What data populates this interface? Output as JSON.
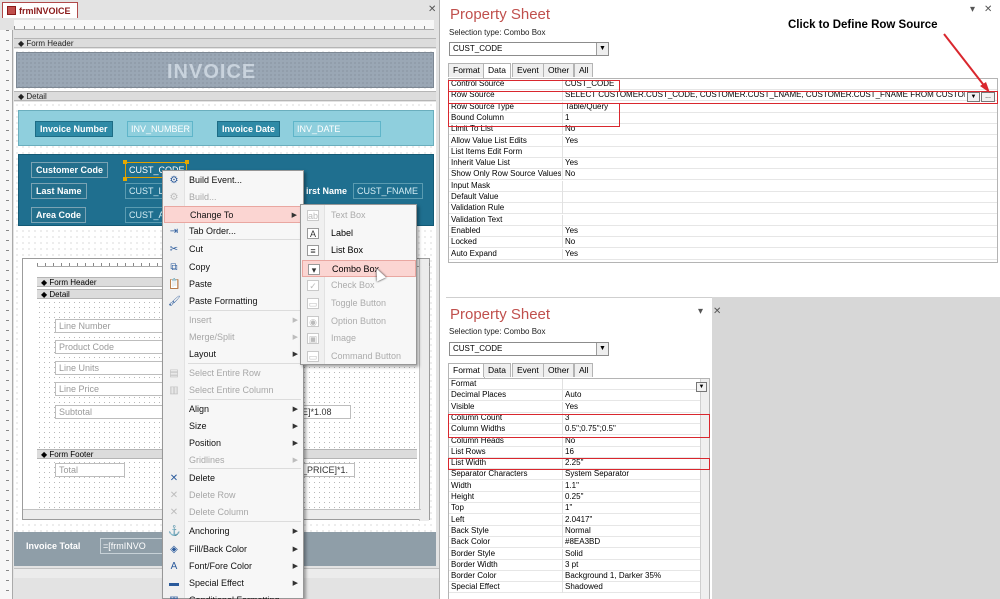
{
  "designer": {
    "tab_label": "frmINVOICE",
    "form_header_section": "Form Header",
    "detail_section": "Detail",
    "invoice_title": "INVOICE",
    "fields": {
      "invoice_number_label": "Invoice Number",
      "invoice_number_value": "INV_NUMBER",
      "invoice_date_label": "Invoice Date",
      "invoice_date_value": "INV_DATE",
      "customer_code_label": "Customer Code",
      "customer_code_value": "CUST_CODE",
      "last_name_label": "Last Name",
      "last_name_value": "CUST_L",
      "first_name_label": "irst Name",
      "first_name_value": "CUST_FNAME",
      "area_code_label": "Area Code",
      "area_code_value": "CUST_A"
    },
    "subform": {
      "form_header_section": "Form Header",
      "detail_section": "Detail",
      "form_footer_section": "Form Footer",
      "detail_fields": [
        "Line Number",
        "Product Code",
        "Line Units",
        "Line Price",
        "Subtotal"
      ],
      "subtotal_expr": "E]*1.08",
      "total_label": "Total",
      "total_expr": "_PRICE]*1."
    },
    "footer": {
      "invoice_total_label": "Invoice Total",
      "invoice_total_expr": "=[frmINVO"
    }
  },
  "context_menu": {
    "items": [
      {
        "label": "Build Event...",
        "icon": "build-event-icon",
        "disabled": false,
        "submenu": false
      },
      {
        "label": "Build...",
        "icon": "build-icon",
        "disabled": true,
        "submenu": false
      },
      {
        "label": "Change To",
        "icon": "",
        "disabled": false,
        "submenu": true,
        "highlighted": true
      },
      {
        "label": "Tab Order...",
        "icon": "tab-order-icon",
        "disabled": false,
        "submenu": false
      },
      {
        "label": "Cut",
        "icon": "scissors-icon",
        "disabled": false,
        "submenu": false
      },
      {
        "label": "Copy",
        "icon": "copy-icon",
        "disabled": false,
        "submenu": false
      },
      {
        "label": "Paste",
        "icon": "paste-icon",
        "disabled": false,
        "submenu": false
      },
      {
        "label": "Paste Formatting",
        "icon": "paste-formatting-icon",
        "disabled": false,
        "submenu": false
      },
      {
        "label": "Insert",
        "icon": "",
        "disabled": true,
        "submenu": true
      },
      {
        "label": "Merge/Split",
        "icon": "",
        "disabled": true,
        "submenu": true
      },
      {
        "label": "Layout",
        "icon": "",
        "disabled": false,
        "submenu": true
      },
      {
        "label": "Select Entire Row",
        "icon": "select-row-icon",
        "disabled": true,
        "submenu": false
      },
      {
        "label": "Select Entire Column",
        "icon": "select-column-icon",
        "disabled": true,
        "submenu": false
      },
      {
        "label": "Align",
        "icon": "",
        "disabled": false,
        "submenu": true
      },
      {
        "label": "Size",
        "icon": "",
        "disabled": false,
        "submenu": true
      },
      {
        "label": "Position",
        "icon": "",
        "disabled": false,
        "submenu": true
      },
      {
        "label": "Gridlines",
        "icon": "",
        "disabled": true,
        "submenu": true
      },
      {
        "label": "Delete",
        "icon": "delete-icon",
        "disabled": false,
        "submenu": false
      },
      {
        "label": "Delete Row",
        "icon": "delete-row-icon",
        "disabled": true,
        "submenu": false
      },
      {
        "label": "Delete Column",
        "icon": "delete-column-icon",
        "disabled": true,
        "submenu": false
      },
      {
        "label": "Anchoring",
        "icon": "anchoring-icon",
        "disabled": false,
        "submenu": true
      },
      {
        "label": "Fill/Back Color",
        "icon": "fill-color-icon",
        "disabled": false,
        "submenu": true
      },
      {
        "label": "Font/Fore Color",
        "icon": "font-color-icon",
        "disabled": false,
        "submenu": true
      },
      {
        "label": "Special Effect",
        "icon": "special-effect-icon",
        "disabled": false,
        "submenu": true
      },
      {
        "label": "Conditional Formatting...",
        "icon": "conditional-formatting-icon",
        "disabled": false,
        "submenu": false
      }
    ]
  },
  "change_to_menu": {
    "items": [
      {
        "label": "Text Box",
        "glyph": "ab",
        "disabled": true
      },
      {
        "label": "Label",
        "glyph": "A",
        "disabled": false
      },
      {
        "label": "List Box",
        "glyph": "≡",
        "disabled": false
      },
      {
        "label": "Combo Box",
        "glyph": "▾",
        "disabled": false,
        "highlighted": true
      },
      {
        "label": "Check Box",
        "glyph": "✓",
        "disabled": true
      },
      {
        "label": "Toggle Button",
        "glyph": "▭",
        "disabled": true
      },
      {
        "label": "Option Button",
        "glyph": "◉",
        "disabled": true
      },
      {
        "label": "Image",
        "glyph": "▣",
        "disabled": true
      },
      {
        "label": "Command Button",
        "glyph": "▭",
        "disabled": true
      }
    ]
  },
  "property_sheet_data": {
    "title": "Property Sheet",
    "selection_type": "Selection type:  Combo Box",
    "selected_control": "CUST_CODE",
    "tabs": [
      "Format",
      "Data",
      "Event",
      "Other",
      "All"
    ],
    "active_tab": "Data",
    "rows": [
      {
        "name": "Control Source",
        "value": "CUST_CODE"
      },
      {
        "name": "Row Source",
        "value": "SELECT CUSTOMER.CUST_CODE, CUSTOMER.CUST_LNAME, CUSTOMER.CUST_FNAME FROM CUSTOMER;"
      },
      {
        "name": "Row Source Type",
        "value": "Table/Query"
      },
      {
        "name": "Bound Column",
        "value": "1"
      },
      {
        "name": "Limit To List",
        "value": "No"
      },
      {
        "name": "Allow Value List Edits",
        "value": "Yes"
      },
      {
        "name": "List Items Edit Form",
        "value": ""
      },
      {
        "name": "Inherit Value List",
        "value": "Yes"
      },
      {
        "name": "Show Only Row Source Values",
        "value": "No"
      },
      {
        "name": "Input Mask",
        "value": ""
      },
      {
        "name": "Default Value",
        "value": ""
      },
      {
        "name": "Validation Rule",
        "value": ""
      },
      {
        "name": "Validation Text",
        "value": ""
      },
      {
        "name": "Enabled",
        "value": "Yes"
      },
      {
        "name": "Locked",
        "value": "No"
      },
      {
        "name": "Auto Expand",
        "value": "Yes"
      }
    ],
    "callout": "Click to Define Row Source",
    "build_button": "..."
  },
  "property_sheet_format": {
    "title": "Property Sheet",
    "selection_type": "Selection type:  Combo Box",
    "selected_control": "CUST_CODE",
    "tabs": [
      "Format",
      "Data",
      "Event",
      "Other",
      "All"
    ],
    "active_tab": "Format",
    "rows": [
      {
        "name": "Format",
        "value": ""
      },
      {
        "name": "Decimal Places",
        "value": "Auto"
      },
      {
        "name": "Visible",
        "value": "Yes"
      },
      {
        "name": "Column Count",
        "value": "3"
      },
      {
        "name": "Column Widths",
        "value": "0.5\";0.75\";0.5\""
      },
      {
        "name": "Column Heads",
        "value": "No"
      },
      {
        "name": "List Rows",
        "value": "16"
      },
      {
        "name": "List Width",
        "value": "2.25\""
      },
      {
        "name": "Separator Characters",
        "value": "System Separator"
      },
      {
        "name": "Width",
        "value": "1.1\""
      },
      {
        "name": "Height",
        "value": "0.25\""
      },
      {
        "name": "Top",
        "value": "1\""
      },
      {
        "name": "Left",
        "value": "2.0417\""
      },
      {
        "name": "Back Style",
        "value": "Normal"
      },
      {
        "name": "Back Color",
        "value": "#8EA3BD"
      },
      {
        "name": "Border Style",
        "value": "Solid"
      },
      {
        "name": "Border Width",
        "value": "3 pt"
      },
      {
        "name": "Border Color",
        "value": "Background 1, Darker 35%"
      },
      {
        "name": "Special Effect",
        "value": "Shadowed"
      }
    ]
  },
  "colors": {
    "title_red": "#c0504d",
    "highlight_red": "#d9272e",
    "band_light": "#8fcfdd",
    "band_dark": "#1f6f8f",
    "menu_hover": "#fbd5d2"
  }
}
